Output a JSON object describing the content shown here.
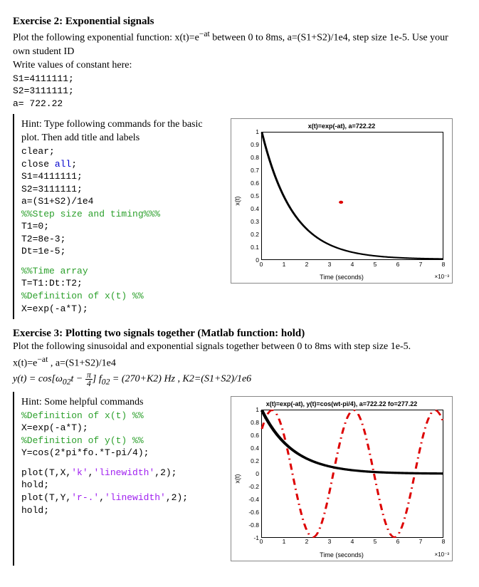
{
  "ex2": {
    "title": "Exercise 2: Exponential signals",
    "desc1a": "Plot the following exponential function: x(t)=e",
    "desc1_exp": "−at",
    "desc1b": "   between 0 to 8ms,  a=(S1+S2)/1e4, step size 1e-5. Use your own student ID",
    "desc2": "Write values of constant here:",
    "s1": "S1=4111111;",
    "s2": "S2=3111111;",
    "a": "a= 722.22"
  },
  "hint2": {
    "intro": "Hint: Type following commands for the basic plot. Then add title and labels",
    "l01": "clear;",
    "l02a": "close ",
    "l02b": "all",
    "l02c": ";",
    "l03": "S1=4111111;",
    "l04": "S2=3111111;",
    "l05": "a=(S1+S2)/1e4",
    "l06": "%%Step size  and timing%%%",
    "l07": "T1=0;",
    "l08": "T2=8e-3;",
    "l09": "Dt=1e-5;",
    "l10": "%%Time array",
    "l11": "T=T1:Dt:T2;",
    "l12": "%Definition of x(t) %%",
    "l13": "X=exp(-a*T);"
  },
  "chart1": {
    "title": "x(t)=exp(-at), a=722.22",
    "xlabel": "Time (seconds)",
    "ylabel": "x(t)",
    "xpow": "×10⁻³",
    "ytick": [
      "0",
      "0.1",
      "0.2",
      "0.3",
      "0.4",
      "0.5",
      "0.6",
      "0.7",
      "0.8",
      "0.9",
      "1"
    ],
    "xtick": [
      "0",
      "1",
      "2",
      "3",
      "4",
      "5",
      "6",
      "7",
      "8"
    ]
  },
  "ex3": {
    "title": "Exercise 3: Plotting two signals together (Matlab function: hold)",
    "desc": "Plot the following sinusoidal and exponential signals together between 0 to 8ms with step size 1e-5.",
    "eq1a": " x(t)=e",
    "eq1_exp": "−at",
    "eq1b": " ,  a=(S1+S2)/1e4",
    "eq2_pre": "y(t) = cos[ω",
    "eq2_sub1": "02",
    "eq2_mid": "t − ",
    "eq2_frac_n": "π",
    "eq2_frac_d": "4",
    "eq2_b": "]  f",
    "eq2_sub2": "02",
    "eq2_c": " = (270+K2) Hz ,  K2=(S1+S2)/1e6"
  },
  "hint3": {
    "intro": "Hint: Some helpful commands",
    "l1": "%Definition of x(t) %%",
    "l2": "X=exp(-a*T);",
    "l3": "%Definition of y(t) %%",
    "l4": "Y=cos(2*pi*fo.*T-pi/4);",
    "l5a": "plot(T,X,",
    "l5b": "'k'",
    "l5c": ",",
    "l5d": "'linewidth'",
    "l5e": ",2);",
    "l6": "hold;",
    "l7a": "plot(T,Y,",
    "l7b": "'r-.'",
    "l7c": ",",
    "l7d": "'linewidth'",
    "l7e": ",2);",
    "l8": "hold;"
  },
  "chart2": {
    "title": "x(t)=exp(-at), y(t)=cos(wt-pi/4), a=722.22 fo=277.22",
    "xlabel": "Time (seconds)",
    "ylabel": "x(t)",
    "xpow": "×10⁻³",
    "ytick": [
      "-1",
      "-0.8",
      "-0.6",
      "-0.4",
      "-0.2",
      "0",
      "0.2",
      "0.4",
      "0.6",
      "0.8",
      "1"
    ],
    "xtick": [
      "0",
      "1",
      "2",
      "3",
      "4",
      "5",
      "6",
      "7",
      "8"
    ]
  },
  "chart_data": [
    {
      "type": "line",
      "title": "x(t)=exp(-at), a=722.22",
      "xlabel": "Time (seconds) ×10⁻³",
      "ylabel": "x(t)",
      "xlim": [
        0,
        8
      ],
      "ylim": [
        0,
        1
      ],
      "series": [
        {
          "name": "x(t)=exp(-722.22*t)",
          "formula": "exp(-722.22*t_ms/1000)",
          "color": "#000"
        }
      ],
      "markers": [
        {
          "x": 3.5,
          "y": 0.45,
          "color": "#d00"
        }
      ]
    },
    {
      "type": "line",
      "title": "x(t)=exp(-at), y(t)=cos(wt-pi/4), a=722.22 fo=277.22",
      "xlabel": "Time (seconds) ×10⁻³",
      "ylabel": "x(t)",
      "xlim": [
        0,
        8
      ],
      "ylim": [
        -1,
        1
      ],
      "series": [
        {
          "name": "x(t)",
          "formula": "exp(-722.22*t_ms/1000)",
          "color": "#000",
          "style": "solid"
        },
        {
          "name": "y(t)",
          "formula": "cos(2*pi*277.22*t_ms/1000 - pi/4)",
          "color": "#d00",
          "style": "dashdot"
        }
      ]
    }
  ]
}
